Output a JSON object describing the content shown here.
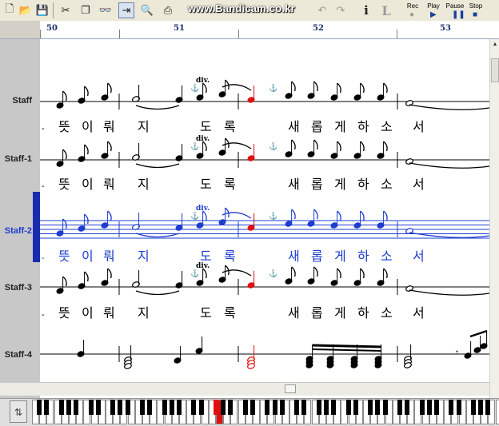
{
  "watermark": "www.Bandicam.co.kr",
  "toolbar": {
    "rec_label": "Rec",
    "play_label": "Play",
    "pause_label": "Pause",
    "stop_label": "Stop",
    "italic_glyph": "i",
    "L_glyph": "L"
  },
  "ruler": {
    "measures": [
      "50",
      "51",
      "52",
      "53"
    ]
  },
  "staves": [
    {
      "name": "Staff"
    },
    {
      "name": "Staff-1"
    },
    {
      "name": "Staff-2"
    },
    {
      "name": "Staff-3"
    },
    {
      "name": "Staff-4"
    }
  ],
  "lyrics": [
    "뜻",
    "이",
    "뤄",
    "지",
    "도",
    "록",
    "새",
    "롭",
    "게",
    "하",
    "소",
    "서"
  ],
  "lyric_prefix": "-",
  "annotation_div": "div.",
  "colors": {
    "active_staff": "#1e3cd0",
    "selected_note": "#e01010",
    "toolbar_bg": "#ece9d8"
  },
  "piano": {
    "pressed_note": "highlighted key"
  }
}
